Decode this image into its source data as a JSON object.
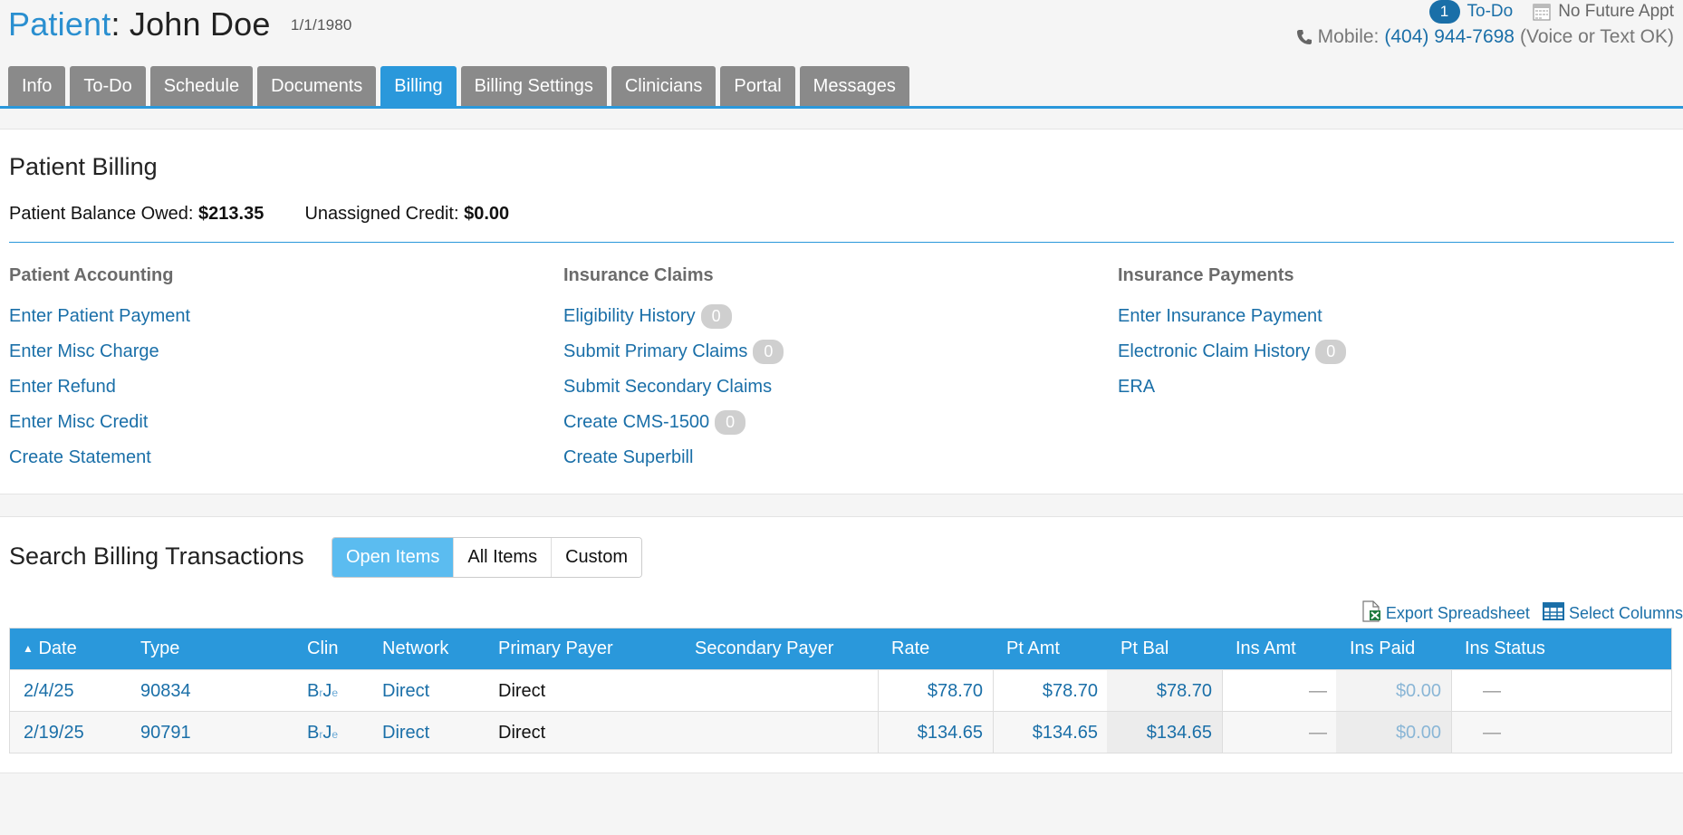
{
  "header": {
    "patient_label": "Patient",
    "colon": ":",
    "patient_name": "John Doe",
    "dob": "1/1/1980",
    "todo_count": "1",
    "todo_label": "To-Do",
    "appt_status": "No Future Appt",
    "mobile_label": "Mobile:",
    "mobile_number": "(404) 944-7698",
    "mobile_note": "(Voice or Text OK)"
  },
  "tabs": [
    {
      "label": "Info"
    },
    {
      "label": "To-Do"
    },
    {
      "label": "Schedule"
    },
    {
      "label": "Documents"
    },
    {
      "label": "Billing",
      "active": true
    },
    {
      "label": "Billing Settings"
    },
    {
      "label": "Clinicians"
    },
    {
      "label": "Portal"
    },
    {
      "label": "Messages"
    }
  ],
  "billing": {
    "title": "Patient Billing",
    "balance_label": "Patient Balance Owed:",
    "balance_value": "$213.35",
    "credit_label": "Unassigned Credit:",
    "credit_value": "$0.00",
    "columns": [
      {
        "heading": "Patient Accounting",
        "links": [
          {
            "label": "Enter Patient Payment"
          },
          {
            "label": "Enter Misc Charge"
          },
          {
            "label": "Enter Refund"
          },
          {
            "label": "Enter Misc Credit"
          },
          {
            "label": "Create Statement"
          }
        ]
      },
      {
        "heading": "Insurance Claims",
        "links": [
          {
            "label": "Eligibility History",
            "count": "0"
          },
          {
            "label": "Submit Primary Claims",
            "count": "0"
          },
          {
            "label": "Submit Secondary Claims"
          },
          {
            "label": "Create CMS-1500",
            "count": "0"
          },
          {
            "label": "Create Superbill"
          }
        ]
      },
      {
        "heading": "Insurance Payments",
        "links": [
          {
            "label": "Enter Insurance Payment"
          },
          {
            "label": "Electronic Claim History",
            "count": "0"
          },
          {
            "label": "ERA"
          }
        ]
      }
    ]
  },
  "search": {
    "title": "Search Billing Transactions",
    "filters": [
      "Open Items",
      "All Items",
      "Custom"
    ],
    "active_filter": "Open Items",
    "export_label": "Export Spreadsheet",
    "columns_label": "Select Columns",
    "headers": [
      "Date",
      "Type",
      "Clin",
      "Network",
      "Primary Payer",
      "Secondary Payer",
      "Rate",
      "Pt Amt",
      "Pt Bal",
      "Ins Amt",
      "Ins Paid",
      "Ins Status"
    ],
    "sort_indicator": "▲",
    "rows": [
      {
        "date": "2/4/25",
        "type": "90834",
        "clin_b": "B",
        "clin_r": "r",
        "clin_j": "J",
        "clin_e": "e",
        "network": "Direct",
        "primary_payer": "Direct",
        "secondary_payer": "",
        "rate": "$78.70",
        "pt_amt": "$78.70",
        "pt_bal": "$78.70",
        "ins_amt": "—",
        "ins_paid": "$0.00",
        "ins_status": "—"
      },
      {
        "date": "2/19/25",
        "type": "90791",
        "clin_b": "B",
        "clin_r": "r",
        "clin_j": "J",
        "clin_e": "e",
        "network": "Direct",
        "primary_payer": "Direct",
        "secondary_payer": "",
        "rate": "$134.65",
        "pt_amt": "$134.65",
        "pt_bal": "$134.65",
        "ins_amt": "—",
        "ins_paid": "$0.00",
        "ins_status": "—"
      }
    ]
  },
  "colors": {
    "accent": "#2a98db",
    "link": "#1a6fa8",
    "tab_inactive": "#8a8a8a"
  }
}
